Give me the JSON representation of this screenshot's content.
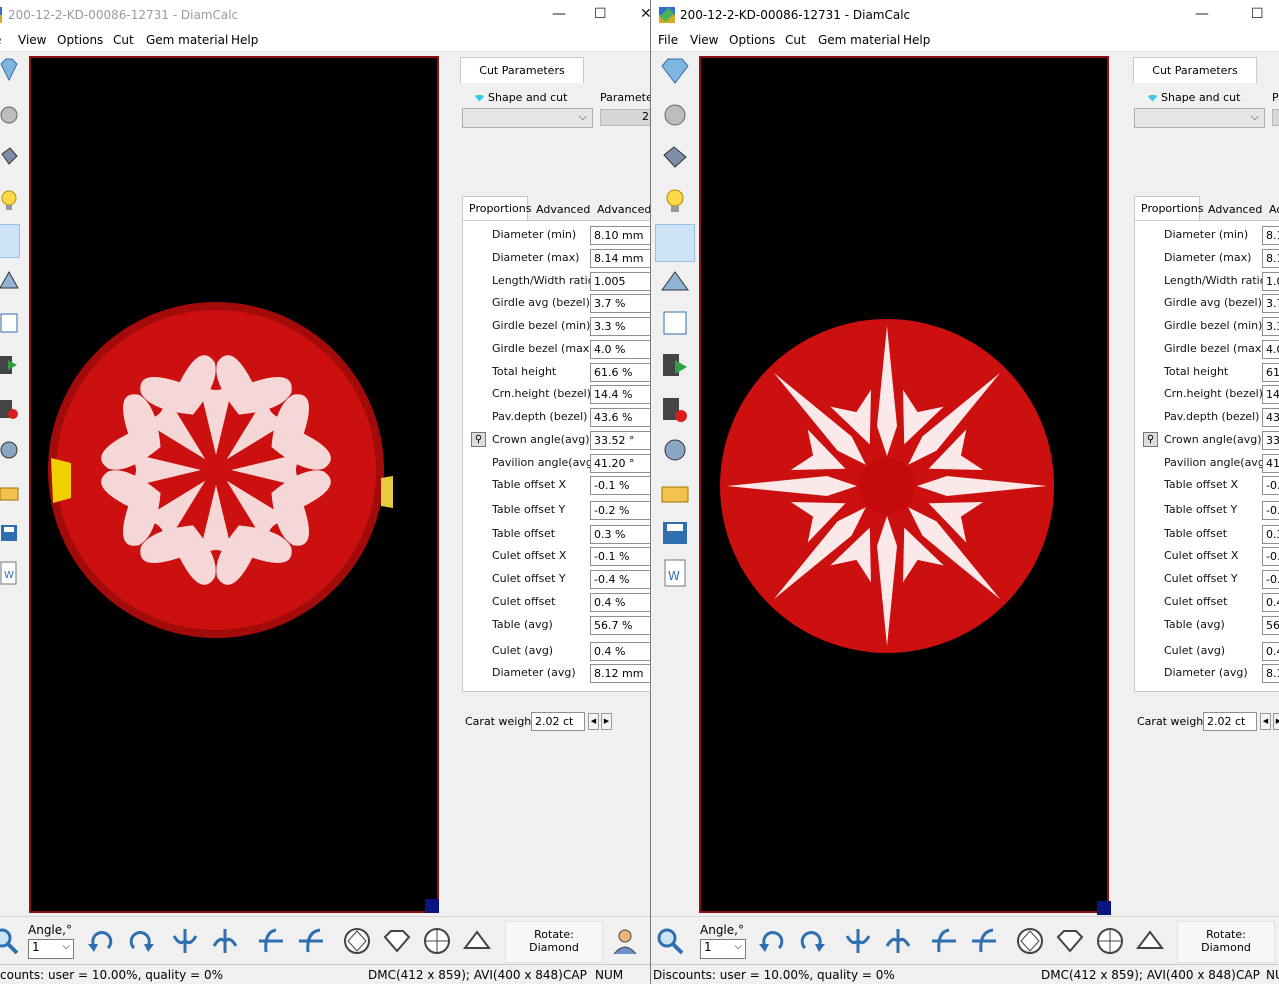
{
  "left": {
    "title": "200-12-2-KD-00086-12731 - DiamCalc",
    "menu": [
      "e",
      "View",
      "Options",
      "Cut",
      "Gem material",
      "Help"
    ],
    "cut_parameters_tab": "Cut Parameters",
    "shape_and_cut_label": "Shape and cut",
    "parameters_label": "Parameter",
    "parameters_value": "2",
    "subtabs": [
      "Proportions",
      "Advanced",
      "Advanced"
    ],
    "props": [
      {
        "label": "Diameter (min)",
        "value": "8.10 mm"
      },
      {
        "label": "Diameter (max)",
        "value": "8.14 mm"
      },
      {
        "label": "Length/Width ratio",
        "value": "1.005"
      },
      {
        "label": "Girdle avg (bezel)",
        "value": "3.7 %"
      },
      {
        "label": "Girdle bezel (min)",
        "value": "3.3 %"
      },
      {
        "label": "Girdle bezel (max)",
        "value": "4.0 %"
      },
      {
        "label": "Total height",
        "value": "61.6 %"
      },
      {
        "label": "Crn.height (bezel)",
        "value": "14.4 %"
      },
      {
        "label": "Pav.depth (bezel)",
        "value": "43.6 %"
      },
      {
        "label": "Crown angle(avg)",
        "value": "33.52 °"
      },
      {
        "label": "Pavilion angle(avg)",
        "value": "41.20 °"
      },
      {
        "label": "Table offset X",
        "value": "-0.1 %"
      },
      {
        "label": "Table offset Y",
        "value": "-0.2 %"
      },
      {
        "label": "Table offset",
        "value": "0.3 %"
      },
      {
        "label": "Culet offset X",
        "value": "-0.1 %"
      },
      {
        "label": "Culet offset Y",
        "value": "-0.4 %"
      },
      {
        "label": "Culet offset",
        "value": "0.4 %"
      },
      {
        "label": "Table (avg)",
        "value": "56.7 %"
      },
      {
        "label": "Culet (avg)",
        "value": "0.4 %"
      },
      {
        "label": "Diameter (avg)",
        "value": "8.12 mm"
      }
    ],
    "carat_label": "Carat weight",
    "carat_value": "2.02 ct",
    "angle_label": "Angle,°",
    "angle_value": "1",
    "rotate_label": "Rotate:",
    "rotate_target": "Diamond",
    "status_discounts": "counts: user = 10.00%, quality = 0%",
    "status_dims": "DMC(412 x 859); AVI(400 x 848)",
    "status_cap": "CAP",
    "status_num": "NUM"
  },
  "right": {
    "title": "200-12-2-KD-00086-12731 - DiamCalc",
    "menu": [
      "File",
      "View",
      "Options",
      "Cut",
      "Gem material",
      "Help"
    ],
    "cut_parameters_tab": "Cut Parameters",
    "shape_and_cut_label": "Shape and cut",
    "parameters_label": "P",
    "subtabs": [
      "Proportions",
      "Advanced",
      "Ac"
    ],
    "props": [
      {
        "label": "Diameter (min)",
        "value": "8.1"
      },
      {
        "label": "Diameter (max)",
        "value": "8.1"
      },
      {
        "label": "Length/Width ratio",
        "value": "1.0"
      },
      {
        "label": "Girdle avg (bezel)",
        "value": "3.7"
      },
      {
        "label": "Girdle bezel (min)",
        "value": "3.3"
      },
      {
        "label": "Girdle bezel (max)",
        "value": "4.0"
      },
      {
        "label": "Total height",
        "value": "61"
      },
      {
        "label": "Crn.height (bezel)",
        "value": "14"
      },
      {
        "label": "Pav.depth (bezel)",
        "value": "43"
      },
      {
        "label": "Crown angle(avg)",
        "value": "33"
      },
      {
        "label": "Pavilion angle(avg)",
        "value": "41"
      },
      {
        "label": "Table offset X",
        "value": "-0."
      },
      {
        "label": "Table offset Y",
        "value": "-0."
      },
      {
        "label": "Table offset",
        "value": "0.3"
      },
      {
        "label": "Culet offset X",
        "value": "-0."
      },
      {
        "label": "Culet offset Y",
        "value": "-0."
      },
      {
        "label": "Culet offset",
        "value": "0.4"
      },
      {
        "label": "Table (avg)",
        "value": "56"
      },
      {
        "label": "Culet (avg)",
        "value": "0.4"
      },
      {
        "label": "Diameter (avg)",
        "value": "8.1"
      }
    ],
    "carat_label": "Carat weight",
    "carat_value": "2.02 ct",
    "angle_label": "Angle,°",
    "angle_value": "1",
    "rotate_label": "Rotate:",
    "rotate_target": "Diamond",
    "status_discounts": "Discounts: user = 10.00%, quality = 0%",
    "status_dims": "DMC(412 x 859); AVI(400 x 848)",
    "status_cap": "CAP",
    "status_num": "NU"
  },
  "colors": {
    "gem_red": "#cc0f0f",
    "viewport_border": "#8a1111",
    "icon_blue": "#2f6fb0"
  }
}
